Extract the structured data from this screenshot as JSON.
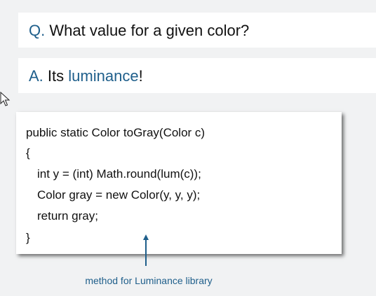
{
  "question": {
    "prefix": "Q.",
    "text": "What value for a given color?"
  },
  "answer": {
    "prefix": "A.",
    "text_before": "Its",
    "keyword": "luminance",
    "text_after": "!"
  },
  "code": {
    "lines": [
      "public static Color toGray(Color c)",
      "{",
      "int y = (int) Math.round(lum(c));",
      "Color gray = new Color(y, y, y);",
      "return gray;",
      "}"
    ]
  },
  "annotation": {
    "caption": "method for Luminance library"
  },
  "colors": {
    "accent": "#1f5f8b",
    "background": "#f1f2f3"
  },
  "icons": {
    "cursor": "mouse-pointer-icon",
    "arrow": "up-arrow-icon"
  }
}
